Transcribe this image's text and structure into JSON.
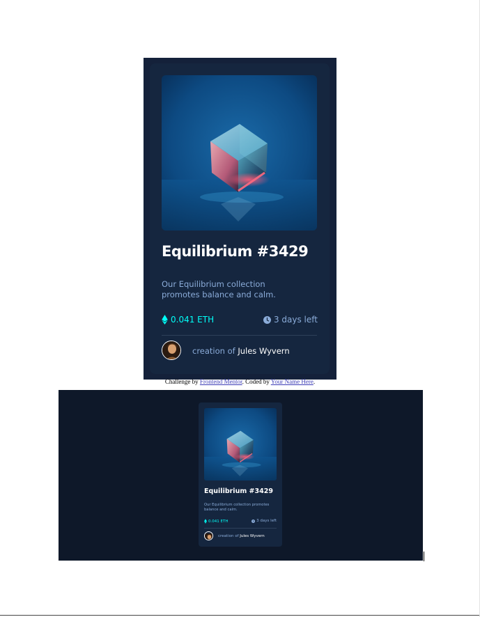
{
  "card": {
    "title": "Equilibrium #3429",
    "description": "Our Equilibrium collection promotes balance and calm.",
    "price": "0.041 ETH",
    "time_left": "3 days left",
    "creation_prefix": "creation of",
    "creator_name": "Jules Wyvern",
    "image_icon": "cube-crystal-image",
    "eth_icon": "ethereum-icon",
    "clock_icon": "clock-icon",
    "avatar_icon": "avatar"
  },
  "attribution": {
    "prefix": "Challenge by",
    "link1": "Frontend Mentor",
    "middle": ". Coded by",
    "link2": "Your Name Here",
    "suffix": "."
  },
  "colors": {
    "page_bg": "#ffffff",
    "preview_bg": "#0e1829",
    "card_bg": "#15263f",
    "frame_bg": "#14213a",
    "cyan": "#00fff8",
    "soft_blue": "#8bacd9",
    "white": "#ffffff",
    "divider": "#2e405a"
  }
}
